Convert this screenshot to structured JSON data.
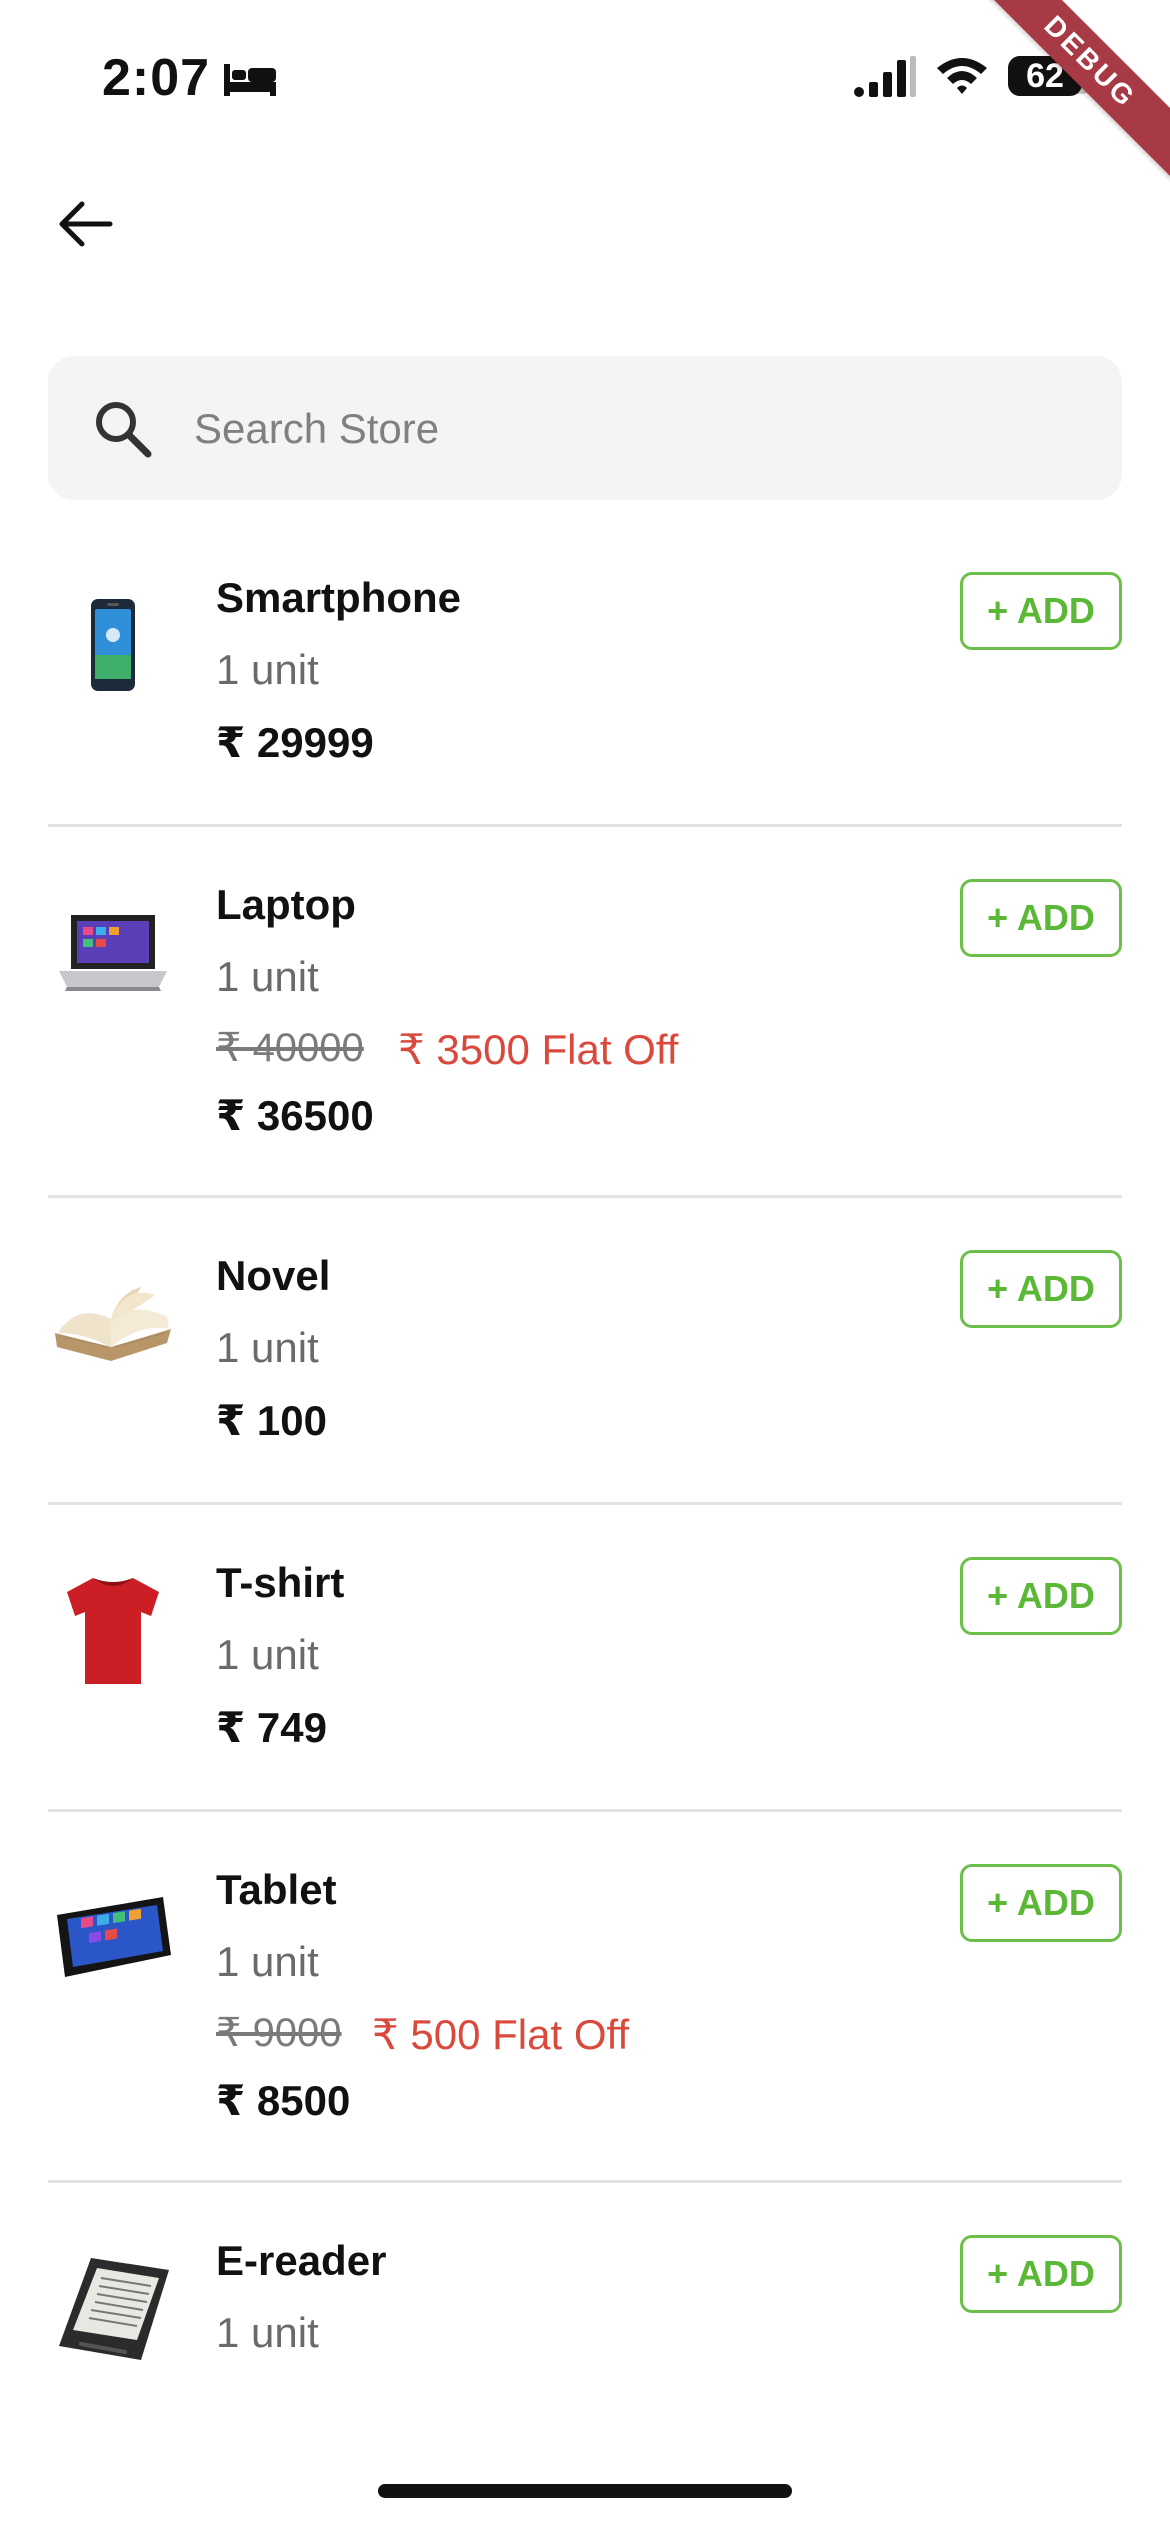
{
  "status_bar": {
    "time": "2:07",
    "battery": "62",
    "debug_label": "DEBUG"
  },
  "header": {
    "back_icon": "arrow-left-icon"
  },
  "search": {
    "placeholder": "Search Store",
    "icon": "search-icon"
  },
  "colors": {
    "accent": "#5bb837",
    "discount": "#d94a3d",
    "divider": "#e3e3e3"
  },
  "products": [
    {
      "name": "Smartphone",
      "unit": "1 unit",
      "price": "₹ 29999",
      "add_label": "+ ADD",
      "icon": "smartphone-icon"
    },
    {
      "name": "Laptop",
      "unit": "1 unit",
      "original_price": "₹ 40000",
      "discount": "₹ 3500 Flat Off",
      "price": "₹ 36500",
      "add_label": "+ ADD",
      "icon": "laptop-icon"
    },
    {
      "name": "Novel",
      "unit": "1 unit",
      "price": "₹ 100",
      "add_label": "+ ADD",
      "icon": "book-icon"
    },
    {
      "name": "T-shirt",
      "unit": "1 unit",
      "price": "₹ 749",
      "add_label": "+ ADD",
      "icon": "tshirt-icon"
    },
    {
      "name": "Tablet",
      "unit": "1 unit",
      "original_price": "₹ 9000",
      "discount": "₹ 500 Flat Off",
      "price": "₹ 8500",
      "add_label": "+ ADD",
      "icon": "tablet-icon"
    },
    {
      "name": "E-reader",
      "unit": "1 unit",
      "add_label": "+ ADD",
      "icon": "ereader-icon"
    }
  ]
}
